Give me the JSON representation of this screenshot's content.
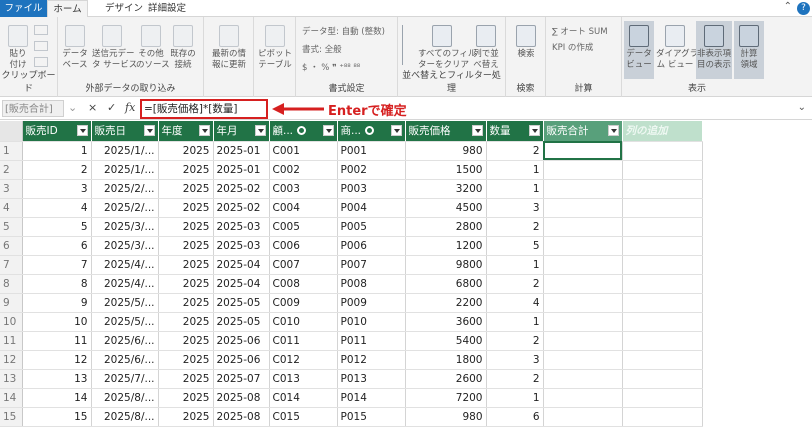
{
  "tabs": {
    "file": "ファイル",
    "home": "ホーム",
    "design": "デザイン",
    "advanced": "詳細設定",
    "help_icon": "?"
  },
  "ribbon": {
    "clipboard": {
      "label": "クリップボード",
      "paste": "貼り\n付け"
    },
    "external": {
      "label": "外部データの取り込み",
      "db": "データ\nベース",
      "service": "送信元デー\nタ サービス",
      "other": "その他\nのソース",
      "existing": "既存の\n接続"
    },
    "refresh": "最新の情\n報に更新",
    "pivot": "ピボット\nテーブル",
    "format": {
      "label": "書式設定",
      "datatype": "データ型: 自動 (整数)",
      "format": "書式: 全般",
      "symbols": "$ ・ % ❞ ⁺⁸⁸ ⁸⁸"
    },
    "sort": {
      "label": "並べ替えとフィルター処理",
      "clear": "すべてのフィル\nターをクリア",
      "sortcol": "列で並\nべ替え"
    },
    "search": {
      "label": "検索",
      "btn": "検索"
    },
    "calc": {
      "label": "計算",
      "autosum": "∑ オート SUM",
      "kpi": "KPI の作成"
    },
    "view": {
      "label": "表示",
      "dataview": "データ\nビュー",
      "diagram": "ダイアグラ\nム ビュー",
      "hidden": "非表示項\n目の表示",
      "calcarea": "計算\n領域"
    }
  },
  "formula_bar": {
    "name_box": "[販売合計]",
    "cancel": "×",
    "confirm": "✓",
    "fx": "fx",
    "formula": "=[販売価格]*[数量]",
    "annotation": "Enterで確定"
  },
  "table": {
    "columns": [
      "販売ID",
      "販売日",
      "年度",
      "年月",
      "顧...",
      "商...",
      "販売価格",
      "数量",
      "販売合計",
      "列の追加"
    ],
    "rows": [
      [
        "1",
        "1",
        "2025/1/...",
        "2025",
        "2025-01",
        "C001",
        "P001",
        "980",
        "2"
      ],
      [
        "2",
        "2",
        "2025/1/...",
        "2025",
        "2025-01",
        "C002",
        "P002",
        "1500",
        "1"
      ],
      [
        "3",
        "3",
        "2025/2/...",
        "2025",
        "2025-02",
        "C003",
        "P003",
        "3200",
        "1"
      ],
      [
        "4",
        "4",
        "2025/2/...",
        "2025",
        "2025-02",
        "C004",
        "P004",
        "4500",
        "3"
      ],
      [
        "5",
        "5",
        "2025/3/...",
        "2025",
        "2025-03",
        "C005",
        "P005",
        "2800",
        "2"
      ],
      [
        "6",
        "6",
        "2025/3/...",
        "2025",
        "2025-03",
        "C006",
        "P006",
        "1200",
        "5"
      ],
      [
        "7",
        "7",
        "2025/4/...",
        "2025",
        "2025-04",
        "C007",
        "P007",
        "9800",
        "1"
      ],
      [
        "8",
        "8",
        "2025/4/...",
        "2025",
        "2025-04",
        "C008",
        "P008",
        "6800",
        "2"
      ],
      [
        "9",
        "9",
        "2025/5/...",
        "2025",
        "2025-05",
        "C009",
        "P009",
        "2200",
        "4"
      ],
      [
        "10",
        "10",
        "2025/5/...",
        "2025",
        "2025-05",
        "C010",
        "P010",
        "3600",
        "1"
      ],
      [
        "11",
        "11",
        "2025/6/...",
        "2025",
        "2025-06",
        "C011",
        "P011",
        "5400",
        "2"
      ],
      [
        "12",
        "12",
        "2025/6/...",
        "2025",
        "2025-06",
        "C012",
        "P012",
        "1800",
        "3"
      ],
      [
        "13",
        "13",
        "2025/7/...",
        "2025",
        "2025-07",
        "C013",
        "P013",
        "2600",
        "2"
      ],
      [
        "14",
        "14",
        "2025/8/...",
        "2025",
        "2025-08",
        "C014",
        "P014",
        "7200",
        "1"
      ],
      [
        "15",
        "15",
        "2025/8/...",
        "2025",
        "2025-08",
        "C015",
        "P015",
        "980",
        "6"
      ]
    ]
  },
  "colors": {
    "header_green": "#217346",
    "selected_header": "#58a07b",
    "annotation_red": "#d62020",
    "file_tab_blue": "#1e73be"
  }
}
